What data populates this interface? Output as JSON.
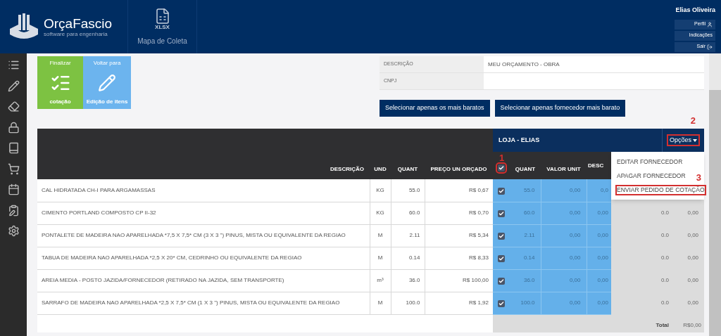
{
  "header": {
    "brand": "OrçaFascio",
    "tagline": "software para engenharia",
    "tool": {
      "file_label": "XLSX",
      "label": "Mapa de Coleta"
    },
    "user": "Elias Oliveira",
    "user_links": [
      {
        "label": "Perfil",
        "kind": "profile"
      },
      {
        "label": "Indicações",
        "kind": "plain"
      },
      {
        "label": "Sair",
        "kind": "logout"
      }
    ]
  },
  "sidebar": {
    "items": [
      {
        "kind": "list"
      },
      {
        "kind": "pencil"
      },
      {
        "kind": "eraser"
      },
      {
        "kind": "lock"
      },
      {
        "kind": "book"
      },
      {
        "kind": "cart"
      },
      {
        "kind": "calendar"
      },
      {
        "kind": "clipboard"
      },
      {
        "kind": "settings"
      }
    ]
  },
  "actions": [
    {
      "top": "Finalizar",
      "bottom": "cotação",
      "kind": "finish"
    },
    {
      "top": "Voltar para",
      "bottom": "Edição de itens",
      "kind": "edit"
    }
  ],
  "info": [
    {
      "label": "DESCRIÇÃO",
      "value": "MEU ORÇAMENTO - OBRA"
    },
    {
      "label": "CNPJ"
    }
  ],
  "select_buttons": [
    "Selecionar apenas os mais baratos",
    "Selecionar apenas fornecedor mais barato"
  ],
  "table": {
    "columns": [
      "DESCRIÇÃO",
      "UND",
      "QUANT",
      "PREÇO UN ORÇADO"
    ],
    "supplier": {
      "name": "LOJA - ELIAS",
      "options": "Opções",
      "options_annotation": "2",
      "check_all": true,
      "check_annotation": "1",
      "columns": [
        "QUANT",
        "VALOR UNIT",
        "DESC"
      ]
    },
    "menu": [
      {
        "label": "EDITAR FORNECEDOR"
      },
      {
        "label": "APAGAR FORNECEDOR"
      },
      {
        "label": "ENVIAR PEDIDO DE COTAÇÃO",
        "annotation": "3"
      }
    ],
    "rows": [
      {
        "description": "CAL HIDRATADA CH-I PARA ARGAMASSAS",
        "unit": "KG",
        "quant": "55.0",
        "price": "R$ 0,67",
        "checked": true,
        "s_quant": "55.0",
        "s_unit": "0,00",
        "s_desc": "0,0"
      },
      {
        "description": "CIMENTO PORTLAND COMPOSTO CP II-32",
        "unit": "KG",
        "quant": "60.0",
        "price": "R$ 0,70",
        "checked": true,
        "s_quant": "60.0",
        "s_unit": "0,00",
        "s_desc": "0,00",
        "column_9": "0.0",
        "column_10": "0,00"
      },
      {
        "description": "PONTALETE DE MADEIRA NAO APARELHADA *7,5 X 7,5* CM (3 X 3 \") PINUS, MISTA OU EQUIVALENTE DA REGIAO",
        "unit": "M",
        "quant": "2.11",
        "price": "R$ 5,34",
        "checked": true,
        "s_quant": "2.11",
        "s_unit": "0,00",
        "s_desc": "0,00",
        "column_9": "0.0",
        "column_10": "0,00"
      },
      {
        "description": "TABUA DE MADEIRA NAO APARELHADA *2,5 X 20* CM, CEDRINHO OU EQUIVALENTE DA REGIAO",
        "unit": "M",
        "quant": "0.14",
        "price": "R$ 8,33",
        "checked": true,
        "s_quant": "0.14",
        "s_unit": "0,00",
        "s_desc": "0,00",
        "column_9": "0.0",
        "column_10": "0,00"
      },
      {
        "description": "AREIA MEDIA - POSTO JAZIDA/FORNECEDOR (RETIRADO NA JAZIDA, SEM TRANSPORTE)",
        "unit": "m³",
        "quant": "36.0",
        "price": "R$ 100,00",
        "checked": true,
        "s_quant": "36.0",
        "s_unit": "0,00",
        "s_desc": "0,00",
        "column_9": "0.0",
        "column_10": "0,00"
      },
      {
        "description": "SARRAFO DE MADEIRA NAO APARELHADA *2,5 X 7,5* CM (1 X 3 \") PINUS, MISTA OU EQUIVALENTE DA REGIAO",
        "unit": "M",
        "quant": "100.0",
        "price": "R$ 1,92",
        "checked": true,
        "s_quant": "100.0",
        "s_unit": "0,00",
        "s_desc": "0,00",
        "column_9": "0.0",
        "column_10": "0,00"
      }
    ],
    "total_label": "Total",
    "total_value": "R$0,00"
  }
}
